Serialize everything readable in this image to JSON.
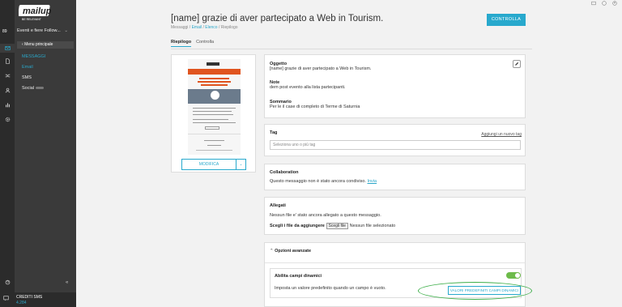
{
  "app": {
    "account_number": "89",
    "brand_name": "Eventi e fiere Follow...",
    "logo_text": "mailup",
    "logo_tagline": "BE RELEVANT"
  },
  "menu": {
    "back_label": "Menu principale",
    "section_head": "MESSAGGI",
    "items": [
      {
        "label": "Email",
        "active": true
      },
      {
        "label": "SMS",
        "active": false
      },
      {
        "label": "Social",
        "active": false
      }
    ]
  },
  "footer": {
    "label": "CREDITI SMS",
    "value": "4.284"
  },
  "header": {
    "title": "[name] grazie di aver partecipato a Web in Tourism.",
    "breadcrumb": [
      "Messaggi",
      "Email",
      "Elenco",
      "Riepilogo"
    ],
    "breadcrumb_sep": " / ",
    "primary_button": "CONTROLLA",
    "tabs": [
      {
        "label": "Riepilogo",
        "active": true
      },
      {
        "label": "Controlla",
        "active": false
      }
    ]
  },
  "preview": {
    "modify_button": "MODIFICA",
    "dropdown_icon": "chevron-down-icon"
  },
  "summary": {
    "subject_label": "Oggetto",
    "subject_value": "[name] grazie di aver partecipato a Web in Tourism.",
    "notes_label": "Note",
    "notes_value": "dem post evento alla lista partecipanti.",
    "summary_label": "Sommario",
    "summary_value": "Per le il case di completo di Terme di Saturnia"
  },
  "tag_section": {
    "label": "Tag",
    "add_link": "Aggiungi un nuovo tag",
    "placeholder": "Seleziona uno o più tag"
  },
  "collaboration": {
    "label": "Collaboration",
    "text": "Questo messaggio non è stato ancora condiviso.",
    "link": "Invia"
  },
  "attachments": {
    "label": "Allegati",
    "text": "Nessun file e' stato ancora allegato a questo messaggio.",
    "choose_label": "Scegli i file da aggiungere",
    "choose_button": "Scegli file",
    "no_file": "Nessun file selezionato"
  },
  "advanced": {
    "header": "Opzioni avanzate",
    "dynamic_label": "Abilita campi dinamici",
    "dynamic_desc": "Imposta un valore predefinito quando un campo è vuoto.",
    "dynamic_enabled": true,
    "dynamic_button": "VALORI PREDEFINITI CAMPI DINAMICI"
  },
  "colors": {
    "accent": "#28a9cd",
    "sidebar": "#3a3a3a",
    "rail": "#2b2b2b",
    "toggle_on": "#6dbb4a",
    "preview_brand": "#e0541f",
    "highlight_oval": "#3cae48"
  }
}
